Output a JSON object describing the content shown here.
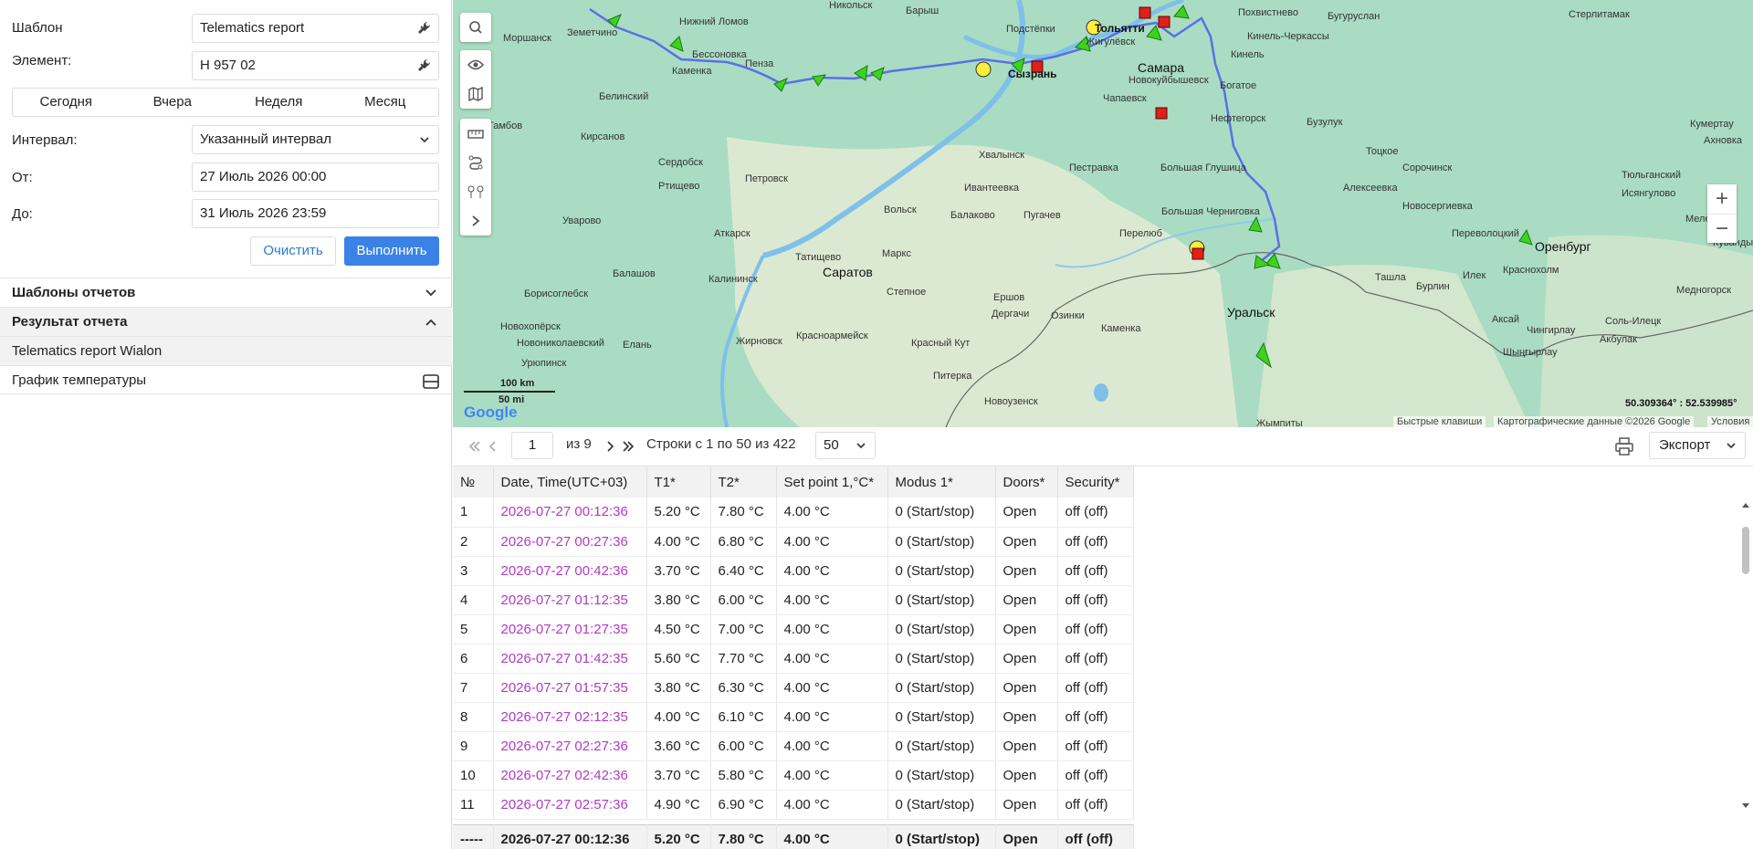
{
  "form": {
    "template_label": "Шаблон",
    "template_value": "Telematics report",
    "element_label": "Элемент:",
    "element_value": "Н 957 02",
    "periods": [
      "Сегодня",
      "Вчера",
      "Неделя",
      "Месяц"
    ],
    "interval_label": "Интервал:",
    "interval_value": "Указанный интервал",
    "from_label": "От:",
    "from_value": "27 Июль 2026 00:00",
    "to_label": "До:",
    "to_value": "31 Июль 2026 23:59",
    "clear_label": "Очистить",
    "run_label": "Выполнить"
  },
  "sections": {
    "templates": "Шаблоны отчетов",
    "result": "Результат отчета",
    "report_item": "Telematics report Wialon",
    "temp_chart": "График температуры"
  },
  "map": {
    "cities": [
      "Нижний Ломов",
      "Земетчино",
      "Моршанск",
      "Бессоновка",
      "Пенза",
      "Каменка",
      "Белинский",
      "Кирсанов",
      "Сердобск",
      "Петровск",
      "Ртищево",
      "Уварово",
      "Аткарск",
      "Балашов",
      "Калининск",
      "Татищево",
      "Саратов",
      "Маркс",
      "Вольск",
      "Балаково",
      "Пугачев",
      "Хвалынск",
      "Пестравка",
      "Большая Глушица",
      "Большая Черниговка",
      "Самара",
      "Тольятти",
      "Жигулёвск",
      "Сызрань",
      "Новокуйбышевск",
      "Чапаевск",
      "Богатое",
      "Нефтегорск",
      "Бузулук",
      "Тоцкое",
      "Сорочинск",
      "Новосергиевка",
      "Оренбург",
      "Переволоцкий",
      "Тюльганский",
      "Исянгулово",
      "Кумертау",
      "Стерлитамак",
      "Бугуруслан",
      "Похвистнево",
      "Кинель-Черкассы",
      "Кинель",
      "Никольск",
      "Барыш",
      "Подстёпки",
      "Ершов",
      "Дергачи",
      "Озинки",
      "Уральск",
      "Каменка",
      "Питерка",
      "Новоузенск",
      "Красный Кут",
      "Красноармейск",
      "Степное",
      "Жирновск",
      "Новониколаевский",
      "Елань",
      "Урюпинск",
      "Борисоглебск",
      "Новохопёрск",
      "Ташла",
      "Илек",
      "Бурлин",
      "Аксай",
      "Краснохолм",
      "Соль-Илецк",
      "Акбулак",
      "Мелеуз",
      "Медногорск",
      "Кувандык",
      "Ивантеевка",
      "Алексеевка",
      "Перелюб",
      "Тамбов",
      "Чингирлау",
      "Шыңғырлау",
      "Жымпиты",
      "Ахновка"
    ],
    "scale_km": "100 km",
    "scale_mi": "50 mi",
    "coords": "50.309364° : 52.539985°",
    "shortcuts": "Быстрые клавиши",
    "mapdata": "Картографические данные ©2026 Google",
    "terms": "Условия",
    "google": "Google"
  },
  "pager": {
    "page": "1",
    "of_pages": "из 9",
    "rows_info": "Строки с 1 по 50 из 422",
    "per_page": "50",
    "export_label": "Экспорт"
  },
  "table": {
    "headers": [
      "№",
      "Date, Time(UTC+03)",
      "T1*",
      "T2*",
      "Set point 1,°C*",
      "Modus 1*",
      "Doors*",
      "Security*"
    ],
    "rows": [
      [
        "1",
        "2026-07-27 00:12:36",
        "5.20 °C",
        "7.80 °C",
        "4.00 °C",
        "0 (Start/stop)",
        "Open",
        "off (off)"
      ],
      [
        "2",
        "2026-07-27 00:27:36",
        "4.00 °C",
        "6.80 °C",
        "4.00 °C",
        "0 (Start/stop)",
        "Open",
        "off (off)"
      ],
      [
        "3",
        "2026-07-27 00:42:36",
        "3.70 °C",
        "6.40 °C",
        "4.00 °C",
        "0 (Start/stop)",
        "Open",
        "off (off)"
      ],
      [
        "4",
        "2026-07-27 01:12:35",
        "3.80 °C",
        "6.00 °C",
        "4.00 °C",
        "0 (Start/stop)",
        "Open",
        "off (off)"
      ],
      [
        "5",
        "2026-07-27 01:27:35",
        "4.50 °C",
        "7.00 °C",
        "4.00 °C",
        "0 (Start/stop)",
        "Open",
        "off (off)"
      ],
      [
        "6",
        "2026-07-27 01:42:35",
        "5.60 °C",
        "7.70 °C",
        "4.00 °C",
        "0 (Start/stop)",
        "Open",
        "off (off)"
      ],
      [
        "7",
        "2026-07-27 01:57:35",
        "3.80 °C",
        "6.30 °C",
        "4.00 °C",
        "0 (Start/stop)",
        "Open",
        "off (off)"
      ],
      [
        "8",
        "2026-07-27 02:12:35",
        "4.00 °C",
        "6.10 °C",
        "4.00 °C",
        "0 (Start/stop)",
        "Open",
        "off (off)"
      ],
      [
        "9",
        "2026-07-27 02:27:36",
        "3.60 °C",
        "6.00 °C",
        "4.00 °C",
        "0 (Start/stop)",
        "Open",
        "off (off)"
      ],
      [
        "10",
        "2026-07-27 02:42:36",
        "3.70 °C",
        "5.80 °C",
        "4.00 °C",
        "0 (Start/stop)",
        "Open",
        "off (off)"
      ],
      [
        "11",
        "2026-07-27 02:57:36",
        "4.90 °C",
        "6.90 °C",
        "4.00 °C",
        "0 (Start/stop)",
        "Open",
        "off (off)"
      ]
    ],
    "total": [
      "-----",
      "2026-07-27 00:12:36",
      "5.20 °C",
      "7.80 °C",
      "4.00 °C",
      "0 (Start/stop)",
      "Open",
      "off (off)"
    ]
  }
}
